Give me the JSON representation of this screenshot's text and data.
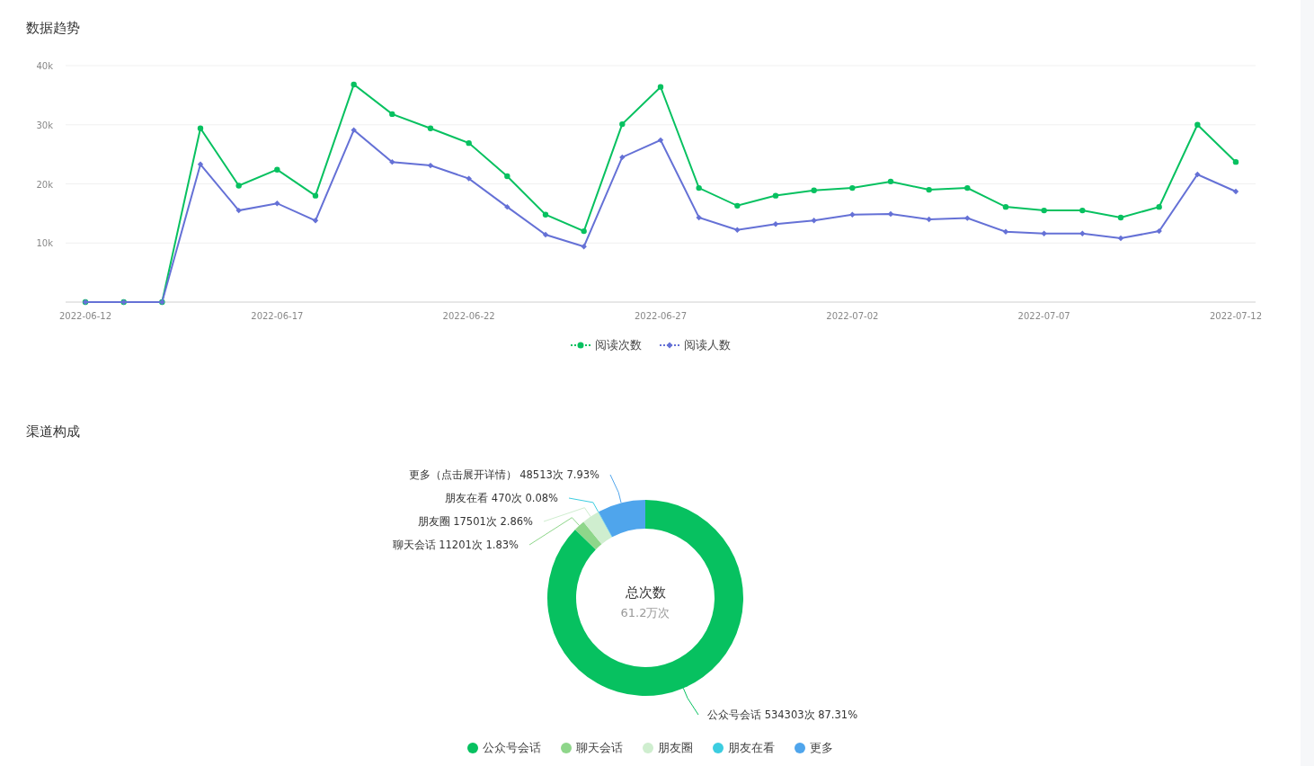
{
  "trend": {
    "title": "数据趋势",
    "chart_data": {
      "type": "line",
      "categories": [
        "2022-06-12",
        null,
        null,
        null,
        null,
        "2022-06-17",
        null,
        null,
        null,
        null,
        "2022-06-22",
        null,
        null,
        null,
        null,
        "2022-06-27",
        null,
        null,
        null,
        null,
        "2022-07-02",
        null,
        null,
        null,
        null,
        "2022-07-07",
        null,
        null,
        null,
        null,
        "2022-07-12"
      ],
      "series": [
        {
          "name": "阅读次数",
          "color": "#07c160",
          "marker": "circle",
          "values": [
            0,
            0,
            0,
            29400,
            19700,
            22400,
            18000,
            36800,
            31800,
            29400,
            26900,
            21300,
            14800,
            12000,
            30100,
            36400,
            19300,
            16300,
            18000,
            18900,
            19300,
            20400,
            19000,
            19300,
            16100,
            15500,
            15500,
            14300,
            16100,
            30000,
            23700
          ]
        },
        {
          "name": "阅读人数",
          "color": "#6571d6",
          "marker": "diamond",
          "values": [
            0,
            0,
            0,
            23300,
            15500,
            16700,
            13800,
            29100,
            23700,
            23100,
            20900,
            16100,
            11400,
            9400,
            24500,
            27400,
            14300,
            12200,
            13200,
            13800,
            14800,
            14900,
            14000,
            14200,
            11900,
            11600,
            11600,
            10800,
            12000,
            21600,
            18700
          ]
        }
      ],
      "ylim": [
        0,
        40000
      ],
      "grid": true,
      "yticks": [
        {
          "value": 10000,
          "label": "10k"
        },
        {
          "value": 20000,
          "label": "20k"
        },
        {
          "value": 30000,
          "label": "30k"
        },
        {
          "value": 40000,
          "label": "40k"
        }
      ],
      "xlabel": null
    }
  },
  "channels": {
    "title": "渠道构成",
    "chart_data": {
      "type": "donut",
      "categories": [
        "公众号会话",
        "聊天会话",
        "朋友圈",
        "朋友在看",
        "更多"
      ],
      "values": [
        87.31,
        1.83,
        2.86,
        0.08,
        7.93
      ],
      "colors": [
        "#07c160",
        "#8ed68a",
        "#cfeecf",
        "#3ccde0",
        "#4fa5ec"
      ]
    },
    "callouts": [
      "更多（点击展开详情） 48513次 7.93%",
      "朋友在看 470次 0.08%",
      "朋友圈 17501次 2.86%",
      "聊天会话 11201次 1.83%",
      "公众号会话 534303次 87.31%"
    ],
    "center_title": "总次数",
    "center_value": "61.2万次"
  }
}
